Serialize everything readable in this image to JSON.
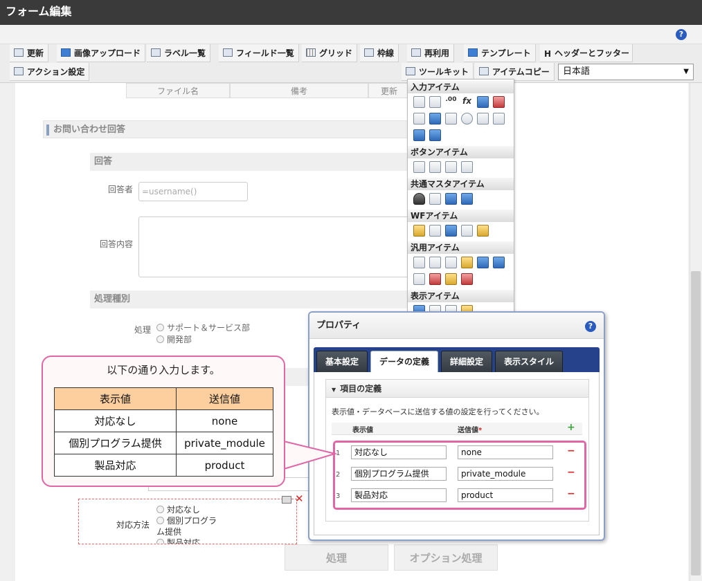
{
  "window": {
    "title": "フォーム編集"
  },
  "toolbar": {
    "update": "更新",
    "image_upload": "画像アップロード",
    "label_list": "ラベル一覧",
    "field_list": "フィールド一覧",
    "grid": "グリッド",
    "border": "枠線",
    "reuse": "再利用",
    "template": "テンプレート",
    "header_footer_icon": "H",
    "header_footer": "ヘッダーとフッター",
    "action_settings": "アクション設定",
    "toolkit": "ツールキット",
    "item_copy": "アイテムコピー",
    "language": "日本語"
  },
  "form": {
    "table_headers": [
      "ファイル名",
      "備考",
      "更新"
    ],
    "section_title": "お問い合わせ回答",
    "answer_head": "回答",
    "responder_label": "回答者",
    "responder_placeholder": "=username()",
    "answer_content_label": "回答内容",
    "process_type_head": "処理種別",
    "process_label": "処理",
    "process_options": [
      "サポート＆サービス部",
      "開発部"
    ],
    "method_label": "対応方法",
    "method_options": [
      "対応なし",
      "個別プログラ",
      "ム提供",
      "製品対応"
    ],
    "process_button": "処理",
    "option_button": "オプション処理"
  },
  "palette": {
    "input_items": "入力アイテム",
    "button_items": "ボタンアイテム",
    "common_master_items": "共通マスタアイテム",
    "wf_items": "WFアイテム",
    "general_items": "汎用アイテム",
    "display_items": "表示アイテム",
    "fx_glyph": "fx",
    "decimal_glyph": ".00"
  },
  "dialog": {
    "title": "プロパティ",
    "tabs": [
      "基本設定",
      "データの定義",
      "詳細設定",
      "表示スタイル"
    ],
    "active_tab": "データの定義",
    "section": "項目の定義",
    "description": "表示値・データベースに送信する値の設定を行ってください。",
    "col_display": "表示値",
    "col_send": "送信値",
    "required_mark": "*",
    "add_symbol": "+",
    "remove_symbol": "−",
    "rows": [
      {
        "num": "1",
        "display": "対応なし",
        "send": "none"
      },
      {
        "num": "2",
        "display": "個別プログラム提供",
        "send": "private_module"
      },
      {
        "num": "3",
        "display": "製品対応",
        "send": "product"
      }
    ]
  },
  "callout": {
    "text": "以下の通り入力します。",
    "headers": [
      "表示値",
      "送信値"
    ],
    "rows": [
      {
        "display": "対応なし",
        "send": "none"
      },
      {
        "display": "個別プログラム提供",
        "send": "private_module"
      },
      {
        "display": "製品対応",
        "send": "product"
      }
    ]
  },
  "colors": {
    "highlight": "#e066a6",
    "tab_bar": "#25428a",
    "callout_header": "#fdcf9e",
    "remove": "#dd2222",
    "add": "#3aa43a"
  },
  "icons": {
    "help": "?",
    "close": "✕",
    "triangle": "▼",
    "dropdown": "▼"
  }
}
